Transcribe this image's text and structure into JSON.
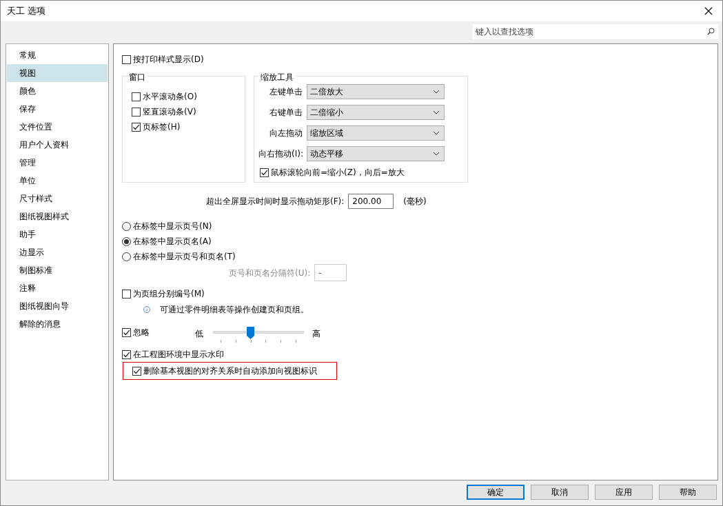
{
  "window": {
    "title": "天工 选项"
  },
  "search": {
    "placeholder": "键入以查找选项"
  },
  "sidebar": {
    "items": [
      {
        "label": "常规",
        "selected": false
      },
      {
        "label": "视图",
        "selected": true
      },
      {
        "label": "颜色",
        "selected": false
      },
      {
        "label": "保存",
        "selected": false
      },
      {
        "label": "文件位置",
        "selected": false
      },
      {
        "label": "用户个人资料",
        "selected": false
      },
      {
        "label": "管理",
        "selected": false
      },
      {
        "label": "单位",
        "selected": false
      },
      {
        "label": "尺寸样式",
        "selected": false
      },
      {
        "label": "图纸视图样式",
        "selected": false
      },
      {
        "label": "助手",
        "selected": false
      },
      {
        "label": "边显示",
        "selected": false
      },
      {
        "label": "制图标准",
        "selected": false
      },
      {
        "label": "注释",
        "selected": false
      },
      {
        "label": "图纸视图向导",
        "selected": false
      },
      {
        "label": "解除的消息",
        "selected": false
      }
    ]
  },
  "print_style": {
    "label": "按打印样式显示(D)",
    "checked": false
  },
  "window_group": {
    "title": "窗口",
    "options": [
      {
        "label": "水平滚动条(O)",
        "checked": false
      },
      {
        "label": "竖直滚动条(V)",
        "checked": false
      },
      {
        "label": "页标签(H)",
        "checked": true
      }
    ]
  },
  "zoom_group": {
    "title": "缩放工具",
    "fields": [
      {
        "label": "左键单击",
        "value": "二倍放大"
      },
      {
        "label": "右键单击",
        "value": "二倍缩小"
      },
      {
        "label": "向左拖动",
        "value": "缩放区域"
      },
      {
        "label": "向右拖动(I):",
        "value": "动态平移"
      }
    ],
    "wheel": {
      "label": "鼠标滚轮向前=缩小(Z)，向后=放大",
      "checked": true
    }
  },
  "drag_rect": {
    "label": "超出全屏显示时间时显示拖动矩形(F):",
    "value": "200.00",
    "unit": "(毫秒)"
  },
  "tab_display": [
    {
      "label": "在标签中显示页号(N)",
      "selected": false
    },
    {
      "label": "在标签中显示页名(A)",
      "selected": true
    },
    {
      "label": "在标签中显示页号和页名(T)",
      "selected": false
    }
  ],
  "separator": {
    "label": "页号和页名分隔符(U):",
    "value": "-",
    "disabled": true
  },
  "group_numbering": {
    "label": "为页组分别编号(M)",
    "checked": false
  },
  "info": {
    "text": "可通过零件明细表等操作创建页和页组。"
  },
  "ignore": {
    "label": "忽略",
    "checked": true,
    "low": "低",
    "high": "高",
    "level": 0.41
  },
  "watermark": {
    "label": "在工程图环境中显示水印",
    "checked": true
  },
  "auto_label": {
    "label": "删除基本视图的对齐关系时自动添加向视图标识",
    "checked": true,
    "highlighted": true
  },
  "buttons": [
    {
      "label": "确定",
      "default": true
    },
    {
      "label": "取消",
      "default": false
    },
    {
      "label": "应用",
      "default": false
    },
    {
      "label": "帮助",
      "default": false
    }
  ]
}
